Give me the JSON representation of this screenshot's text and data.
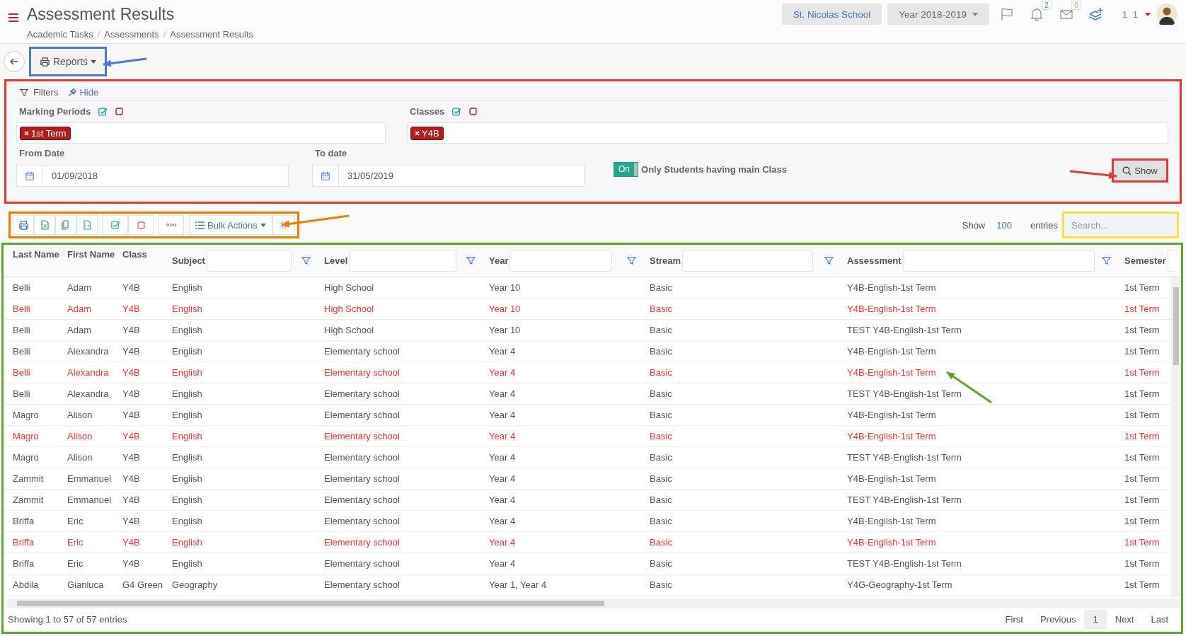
{
  "header": {
    "title": "Assessment Results",
    "breadcrumb": [
      {
        "label": "Academic Tasks"
      },
      {
        "separator": "/",
        "label": "Assessments"
      },
      {
        "separator": "/",
        "label": "Assessment Results"
      }
    ],
    "school": "St. Nicolas School",
    "year": "Year 2018-2019",
    "notifications": "2",
    "messages": "0",
    "user": "1 1"
  },
  "actions": {
    "reports": "Reports"
  },
  "filters": {
    "title": "Filters",
    "hide": "Hide",
    "marking_periods": {
      "label": "Marking Periods",
      "tags": [
        "1st Term"
      ]
    },
    "classes": {
      "label": "Classes",
      "tags": [
        "Y4B"
      ]
    },
    "from_date": {
      "label": "From Date",
      "value": "01/09/2018"
    },
    "to_date": {
      "label": "To date",
      "value": "31/05/2019"
    },
    "main_class": {
      "on": true,
      "state_label": "On",
      "label": "Only Students having main Class"
    },
    "show": "Show"
  },
  "toolbar": {
    "bulk_actions": "Bulk Actions",
    "show": "Show",
    "entries_count": "100",
    "entries": "entries",
    "search_placeholder": "Search..."
  },
  "table": {
    "columns": [
      {
        "label": "Last Name",
        "kind": "plain"
      },
      {
        "label": "First Name",
        "kind": "plain"
      },
      {
        "label": "Class",
        "kind": "plain"
      },
      {
        "label": "Subject",
        "kind": "filtered"
      },
      {
        "label": "Level",
        "kind": "filtered"
      },
      {
        "label": "Year",
        "kind": "filtered"
      },
      {
        "label": "Stream",
        "kind": "filtered"
      },
      {
        "label": "Assessment",
        "kind": "filtered"
      },
      {
        "label": "Semester",
        "kind": "filtered"
      }
    ],
    "rows": [
      {
        "highlighted": false,
        "cells": [
          "Belli",
          "Adam",
          "Y4B",
          "English",
          "High School",
          "Year 10",
          "Basic",
          "Y4B-English-1st Term",
          "1st Term"
        ]
      },
      {
        "highlighted": true,
        "cells": [
          "Belli",
          "Adam",
          "Y4B",
          "English",
          "High School",
          "Year 10",
          "Basic",
          "Y4B-English-1st Term",
          "1st Term"
        ]
      },
      {
        "highlighted": false,
        "cells": [
          "Belli",
          "Adam",
          "Y4B",
          "English",
          "High School",
          "Year 10",
          "Basic",
          "TEST Y4B-English-1st Term",
          "1st Term"
        ]
      },
      {
        "highlighted": false,
        "cells": [
          "Belli",
          "Alexandra",
          "Y4B",
          "English",
          "Elementary school",
          "Year 4",
          "Basic",
          "Y4B-English-1st Term",
          "1st Term"
        ]
      },
      {
        "highlighted": true,
        "cells": [
          "Belli",
          "Alexandra",
          "Y4B",
          "English",
          "Elementary school",
          "Year 4",
          "Basic",
          "Y4B-English-1st Term",
          "1st Term"
        ]
      },
      {
        "highlighted": false,
        "cells": [
          "Belli",
          "Alexandra",
          "Y4B",
          "English",
          "Elementary school",
          "Year 4",
          "Basic",
          "TEST Y4B-English-1st Term",
          "1st Term"
        ]
      },
      {
        "highlighted": false,
        "cells": [
          "Magro",
          "Alison",
          "Y4B",
          "English",
          "Elementary school",
          "Year 4",
          "Basic",
          "Y4B-English-1st Term",
          "1st Term"
        ]
      },
      {
        "highlighted": true,
        "cells": [
          "Magro",
          "Alison",
          "Y4B",
          "English",
          "Elementary school",
          "Year 4",
          "Basic",
          "Y4B-English-1st Term",
          "1st Term"
        ]
      },
      {
        "highlighted": false,
        "cells": [
          "Magro",
          "Alison",
          "Y4B",
          "English",
          "Elementary school",
          "Year 4",
          "Basic",
          "TEST Y4B-English-1st Term",
          "1st Term"
        ]
      },
      {
        "highlighted": false,
        "cells": [
          "Zammit",
          "Emmanuel",
          "Y4B",
          "English",
          "Elementary school",
          "Year 4",
          "Basic",
          "Y4B-English-1st Term",
          "1st Term"
        ]
      },
      {
        "highlighted": false,
        "cells": [
          "Zammit",
          "Emmanuel",
          "Y4B",
          "English",
          "Elementary school",
          "Year 4",
          "Basic",
          "TEST Y4B-English-1st Term",
          "1st Term"
        ]
      },
      {
        "highlighted": false,
        "cells": [
          "Briffa",
          "Eric",
          "Y4B",
          "English",
          "Elementary school",
          "Year 4",
          "Basic",
          "Y4B-English-1st Term",
          "1st Term"
        ]
      },
      {
        "highlighted": true,
        "cells": [
          "Briffa",
          "Eric",
          "Y4B",
          "English",
          "Elementary school",
          "Year 4",
          "Basic",
          "Y4B-English-1st Term",
          "1st Term"
        ]
      },
      {
        "highlighted": false,
        "cells": [
          "Briffa",
          "Eric",
          "Y4B",
          "English",
          "Elementary school",
          "Year 4",
          "Basic",
          "TEST Y4B-English-1st Term",
          "1st Term"
        ]
      },
      {
        "highlighted": false,
        "cells": [
          "Abdila",
          "Gianluca",
          "G4 Green",
          "Geography",
          "Elementary school",
          "Year 1, Year 4",
          "Basic",
          "Y4G-Geography-1st Term",
          "1st Term"
        ]
      }
    ],
    "summary": "Showing 1 to 57 of 57 entries",
    "pagination": [
      {
        "label": "First",
        "selected": false
      },
      {
        "label": "Previous",
        "selected": false
      },
      {
        "label": "1",
        "selected": true
      },
      {
        "label": "Next",
        "selected": false
      },
      {
        "label": "Last",
        "selected": false
      }
    ]
  }
}
